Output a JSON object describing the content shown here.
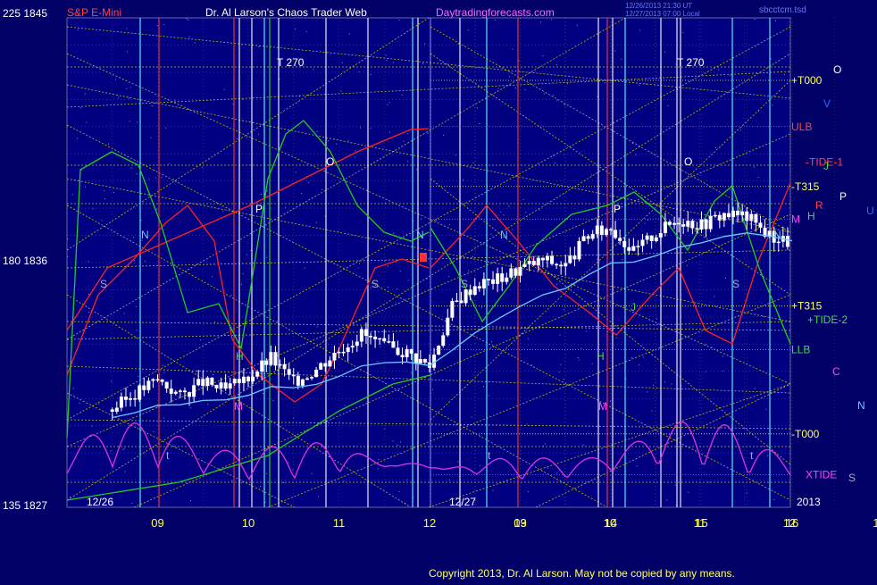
{
  "header": {
    "left_scale_top": "225  1845",
    "instrument": "S&P E-Mini",
    "site_title": "Dr. Al Larson's Chaos Trader Web",
    "site_url": "Daytradingforecasts.com",
    "stamp_line1": "12/26/2013 21:30 UT",
    "stamp_line2": "12/27/2013 07:00 Local",
    "software": "sbcctcm.tsd"
  },
  "left_scale": {
    "mid": "180  1836",
    "bottom": "135  1827"
  },
  "footer": {
    "copyright": "Copyright 2013, Dr. Al Larson. May not be copied by any means."
  },
  "colors": {
    "background": "#000066",
    "plot_bg": "#000080",
    "grid": "#8888aa",
    "yellow_lines": "#e6e600",
    "price": "#ffffff",
    "ma": "#66ccff",
    "red_flux": "#ff2222",
    "green_flux": "#22cc22",
    "xtide": "#dd33dd",
    "white_vertical": "#ffffff",
    "cyan_vertical": "#66ffff",
    "red_vertical": "#ff3333",
    "green_vertical": "#33dd33"
  },
  "chart_data": {
    "type": "line",
    "title": "S&P E-Mini",
    "price_range": [
      1827,
      1845
    ],
    "xaxis": {
      "day_labels": [
        "12/26",
        "12/27"
      ],
      "hour_labels": [
        "09",
        "10",
        "11",
        "12",
        "13",
        "14",
        "15",
        "16",
        "09",
        "10",
        "11",
        "12",
        "13",
        "14",
        "15",
        "16"
      ],
      "year": "2013"
    },
    "right_levels": [
      {
        "label": "+T000",
        "price": 1842.7,
        "color": "#ffff66"
      },
      {
        "label": "ULB",
        "price": 1841.0,
        "color": "#ff4444"
      },
      {
        "label": "-TIDE-1",
        "price": 1839.7,
        "color": "#ff4444"
      },
      {
        "label": "-T315",
        "price": 1838.8,
        "color": "#ffff66"
      },
      {
        "label": "M",
        "price": 1837.6,
        "color": "#ff44ff"
      },
      {
        "label": "H",
        "price": 1837.7,
        "color": "#44dd44"
      },
      {
        "label": "+T315",
        "price": 1834.4,
        "color": "#ffff66"
      },
      {
        "label": "+TIDE-2",
        "price": 1833.9,
        "color": "#44dd44"
      },
      {
        "label": "LLB",
        "price": 1832.8,
        "color": "#44dd44"
      },
      {
        "label": "-T000",
        "price": 1829.7,
        "color": "#ffff66"
      },
      {
        "label": "XTIDE",
        "price": 1828.2,
        "color": "#ff44ff"
      }
    ],
    "side_markers": [
      {
        "label": "O",
        "color": "#ffffff"
      },
      {
        "label": "V",
        "color": "#3366ff"
      },
      {
        "label": "J",
        "color": "#44dd44"
      },
      {
        "label": "P",
        "color": "#ffffff"
      },
      {
        "label": "R",
        "color": "#ff4444"
      },
      {
        "label": "U",
        "color": "#3366ff"
      },
      {
        "label": "C",
        "color": "#ff44ff"
      },
      {
        "label": "N",
        "color": "#66ccff"
      },
      {
        "label": "S",
        "color": "#aaaacc"
      }
    ],
    "price_series": {
      "name": "S&P E-Mini",
      "hours": [
        8.5,
        8.75,
        9.0,
        9.25,
        9.5,
        9.75,
        10.0,
        10.25,
        10.5,
        10.75,
        11.0,
        11.25,
        11.5,
        11.75,
        12.0,
        12.25,
        12.5,
        12.75,
        13.0,
        13.25,
        13.5,
        13.75,
        14.0,
        14.25,
        14.5,
        14.75,
        15.0,
        15.25,
        15.5,
        15.75,
        16.0
      ],
      "close": [
        1830.6,
        1831.2,
        1831.7,
        1831.1,
        1831.6,
        1831.3,
        1831.8,
        1832.5,
        1831.6,
        1832.1,
        1832.8,
        1833.4,
        1832.9,
        1832.7,
        1832.2,
        1834.4,
        1835.2,
        1835.4,
        1835.8,
        1836.1,
        1835.9,
        1837.0,
        1837.3,
        1836.4,
        1837.1,
        1837.6,
        1837.4,
        1837.8,
        1837.7,
        1837.0,
        1836.7
      ]
    },
    "annotations": [
      "T   270",
      "T   270",
      "O",
      "P",
      "N",
      "S",
      "H",
      "M",
      "J",
      "t"
    ]
  }
}
